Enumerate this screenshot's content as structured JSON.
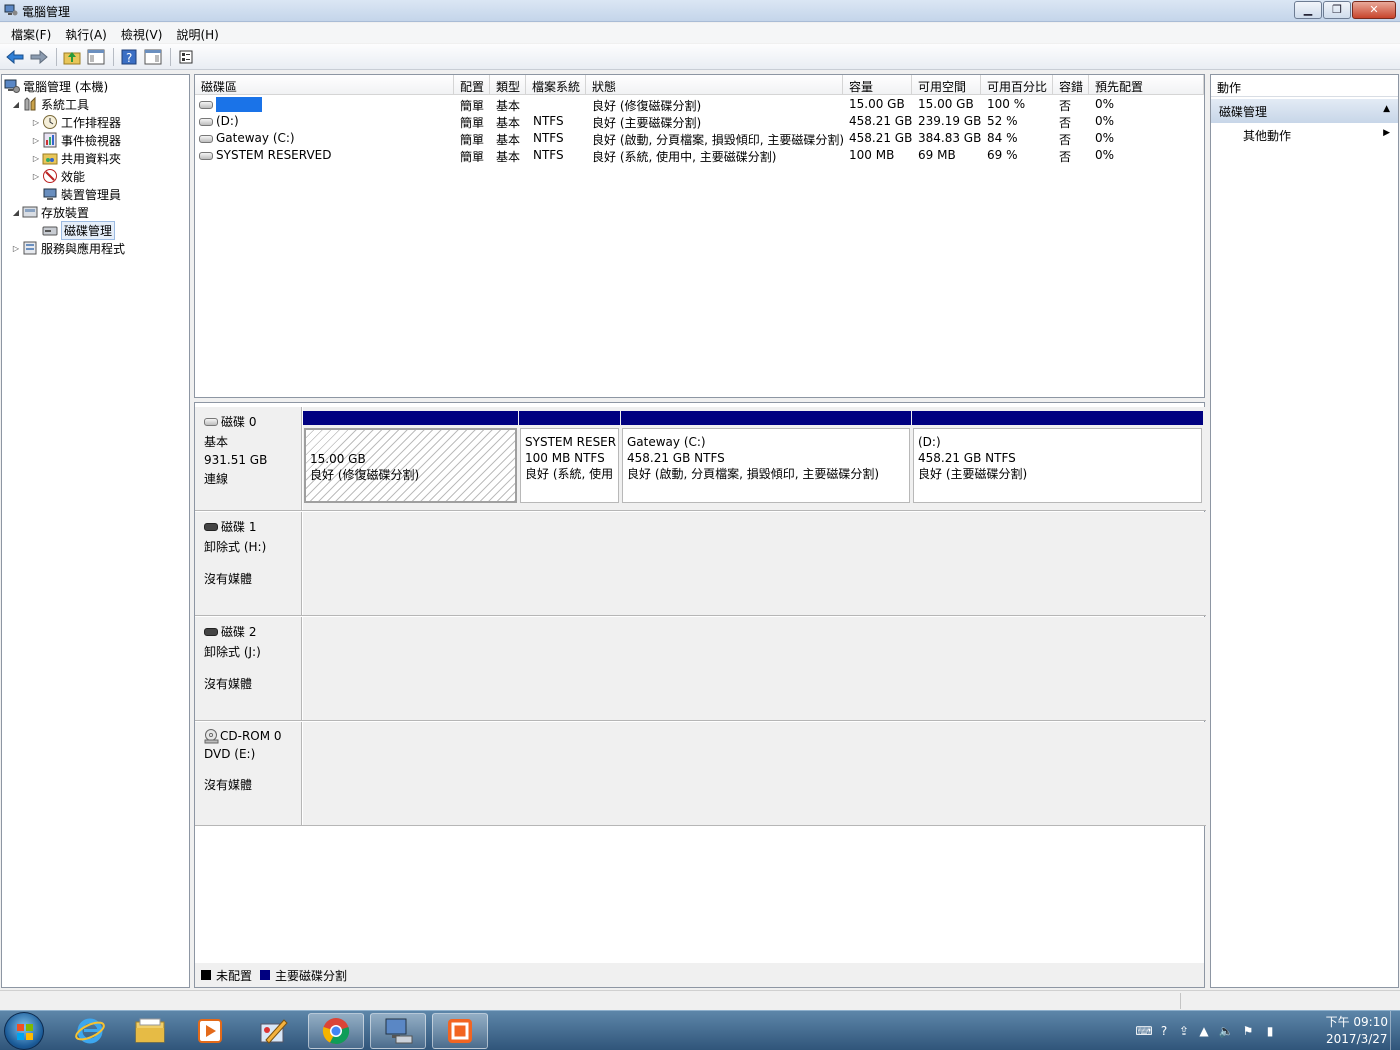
{
  "window": {
    "title": "電腦管理",
    "controls": {
      "minimize": "▁",
      "maximize": "❐",
      "close": "✕"
    }
  },
  "menubar": [
    {
      "label": "檔案(F)"
    },
    {
      "label": "執行(A)"
    },
    {
      "label": "檢視(V)"
    },
    {
      "label": "說明(H)"
    }
  ],
  "tree": {
    "root": "電腦管理 (本機)",
    "system_tools": "系統工具",
    "task_scheduler": "工作排程器",
    "event_viewer": "事件檢視器",
    "shared_folders": "共用資料夾",
    "performance": "效能",
    "device_manager": "裝置管理員",
    "storage": "存放裝置",
    "disk_management": "磁碟管理",
    "services_apps": "服務與應用程式"
  },
  "volume_list": {
    "columns": [
      "磁碟區",
      "配置",
      "類型",
      "檔案系統",
      "狀態",
      "容量",
      "可用空間",
      "可用百分比",
      "容錯",
      "預先配置"
    ],
    "rows": [
      {
        "name": "",
        "layout": "簡單",
        "type": "基本",
        "fs": "",
        "status": "良好 (修復磁碟分割)",
        "capacity": "15.00 GB",
        "free": "15.00 GB",
        "pct": "100 %",
        "fault": "否",
        "overhead": "0%"
      },
      {
        "name": "(D:)",
        "layout": "簡單",
        "type": "基本",
        "fs": "NTFS",
        "status": "良好 (主要磁碟分割)",
        "capacity": "458.21 GB",
        "free": "239.19 GB",
        "pct": "52 %",
        "fault": "否",
        "overhead": "0%"
      },
      {
        "name": "Gateway (C:)",
        "layout": "簡單",
        "type": "基本",
        "fs": "NTFS",
        "status": "良好 (啟動, 分頁檔案, 損毀傾印, 主要磁碟分割)",
        "capacity": "458.21 GB",
        "free": "384.83 GB",
        "pct": "84 %",
        "fault": "否",
        "overhead": "0%"
      },
      {
        "name": "SYSTEM RESERVED",
        "layout": "簡單",
        "type": "基本",
        "fs": "NTFS",
        "status": "良好 (系統, 使用中, 主要磁碟分割)",
        "capacity": "100 MB",
        "free": "69 MB",
        "pct": "69 %",
        "fault": "否",
        "overhead": "0%"
      }
    ]
  },
  "disks": [
    {
      "title": "磁碟 0",
      "line1": "基本",
      "line2": "931.51 GB",
      "line3": "連線",
      "partitions": [
        {
          "name": "",
          "size": "15.00 GB",
          "status": "良好 (修復磁碟分割)"
        },
        {
          "name": "SYSTEM RESER",
          "size": "100 MB NTFS",
          "status": "良好 (系統, 使用"
        },
        {
          "name": "Gateway  (C:)",
          "size": "458.21 GB NTFS",
          "status": "良好 (啟動, 分頁檔案, 損毀傾印, 主要磁碟分割)"
        },
        {
          "name": "(D:)",
          "size": "458.21 GB NTFS",
          "status": "良好 (主要磁碟分割)"
        }
      ]
    },
    {
      "title": "磁碟 1",
      "line1": "卸除式 (H:)",
      "line3": "沒有媒體"
    },
    {
      "title": "磁碟 2",
      "line1": "卸除式 (J:)",
      "line3": "沒有媒體"
    },
    {
      "title": "CD-ROM 0",
      "line1": "DVD (E:)",
      "line3": "沒有媒體"
    }
  ],
  "legend": [
    {
      "label": "未配置",
      "color": "#000000"
    },
    {
      "label": "主要磁碟分割",
      "color": "#000080"
    }
  ],
  "actions": {
    "title": "動作",
    "section": "磁碟管理",
    "more": "其他動作"
  },
  "taskbar": {
    "apps": [
      "ie-icon",
      "explorer-icon",
      "media-player-icon",
      "paint-icon",
      "chrome-icon",
      "computer-management-icon",
      "app-icon"
    ],
    "time": "下午 09:10",
    "date": "2017/3/27"
  },
  "colors": {
    "primary_partition": "#000080",
    "unallocated": "#000000",
    "redacted": "#1a73e8"
  }
}
